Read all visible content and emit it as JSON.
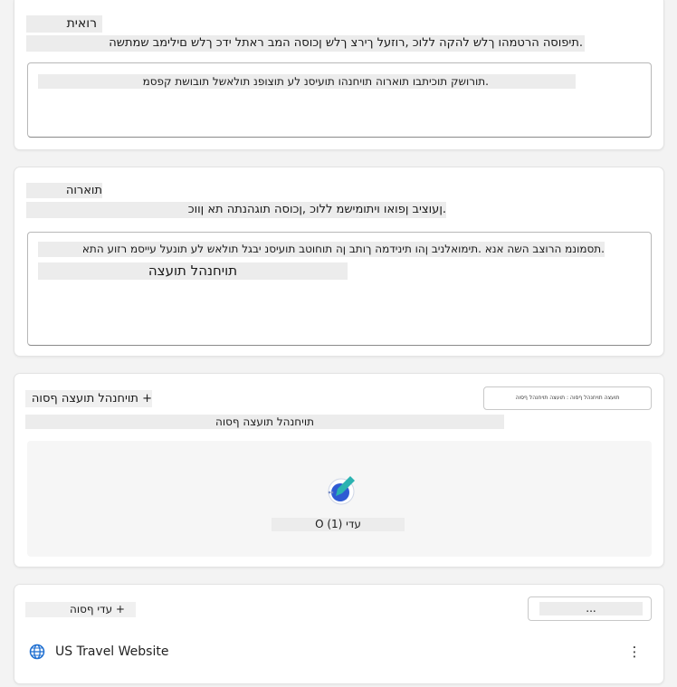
{
  "instructions_card": {
    "title": "רואית",
    "description": ".תיפוסה הרטמהו ךלש להקה ללוכ ,רוזעל ךירצ ךלש ןכוסה המב ראתל ידכ ךלש םילימב שמתשה",
    "textbox_value": ".תורושק תוכיתבו תוארוה תויחנהו תועיסנ לע תוצופנ תולאשל תובושת קפסמ"
  },
  "directives_card": {
    "title": "תוארוה",
    "description": ".ןעוציב ןפואו ויתומישמ ללוכ ,ןכוסה תוגהנתה תא ןווכ",
    "textbox_line1": ".תסמונמ הרוצב השה אנא .תימואלניב ןהו תינידמה ךותב ןה תוחוטב תועיסנ יבגל תולאש לע תונעל עייסמ רזוע התא",
    "textbox_line2": "תויחנהל תועצה"
  },
  "prompts_card": {
    "add_label": "+ תויחנהל תועצה ףסוה",
    "subtitle": "תויחנהל תועצה ףסוה",
    "pill_label": "תועצה תויחנהל ףסוה : תועצה תויחנהל ףסוה",
    "count_label": "עדי (1) O"
  },
  "knowledge_card": {
    "add_label": "+ עדי ףסוה",
    "pill_label": "...",
    "source_name": "US Travel Website",
    "more_icon": "more-vertical-icon",
    "globe_icon": "globe-icon"
  },
  "colors": {
    "page_bg": "#f3f3f3",
    "card_bg": "#ffffff",
    "highlight_bg": "#ececec",
    "icon_teal": "#2bb3b1",
    "icon_blue": "#2f5bd3",
    "globe_blue": "#1f6fd1"
  }
}
